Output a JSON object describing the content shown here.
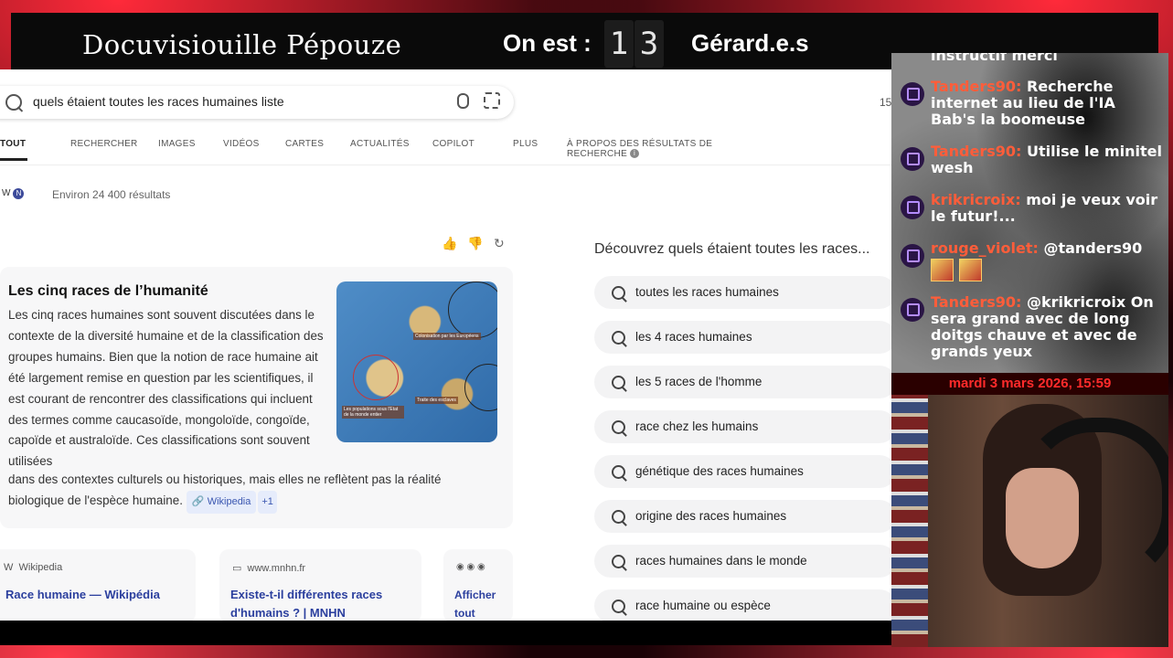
{
  "overlay": {
    "left_title": "Docuvisiouille Pépouze",
    "counter_label": "On est :",
    "counter_digits": [
      "1",
      "3"
    ],
    "right_title": "Gérard.e.s"
  },
  "search": {
    "query": "quels étaient toutes les races humaines liste",
    "corner_count": "15"
  },
  "tabs": [
    {
      "label": "TOUT",
      "active": true
    },
    {
      "label": "RECHERCHER"
    },
    {
      "label": "IMAGES"
    },
    {
      "label": "VIDÉOS"
    },
    {
      "label": "CARTES"
    },
    {
      "label": "ACTUALITÉS"
    },
    {
      "label": "COPILOT"
    },
    {
      "label": "PLUS"
    },
    {
      "label": "À PROPOS DES RÉSULTATS DE RECHERCHE"
    }
  ],
  "results": {
    "badge_w": "W",
    "badge_n": "N",
    "count": "Environ 24 400 résultats"
  },
  "answer_card": {
    "title": "Les cinq races de l’humanité",
    "body": "Les cinq races humaines sont souvent discutées dans le contexte de la diversité humaine et de la classification des groupes humains. Bien que la notion de race humaine ait été largement remise en question par les scientifiques, il est courant de rencontrer des classifications qui incluent des termes comme caucasoïde, mongoloïde, congoïde, capoïde et australoïde. Ces classifications sont souvent utilisées",
    "body_tail": "dans des contextes culturels ou historiques, mais elles ne reflètent pas la réalité biologique de l'espèce humaine.",
    "chip_wiki": "Wikipedia",
    "chip_plus": "+1",
    "map_labels": [
      "Colonisation par les Européens",
      "Traite des esclaves",
      "Les populations sous l'Etat de la monde entier"
    ]
  },
  "sources": [
    {
      "site": "Wikipedia",
      "title": "Race humaine — Wikipédia"
    },
    {
      "site": "www.mnhn.fr",
      "title": "Existe-t-il différentes races d'humains ? | MNHN"
    },
    {
      "title": "Afficher tout"
    }
  ],
  "aside": {
    "title": "Découvrez quels étaient toutes les races...",
    "suggestions": [
      "toutes les races humaines",
      "les 4 races humaines",
      "les 5 races de l'homme",
      "race chez les humains",
      "génétique des races humaines",
      "origine des races humaines",
      "races humaines dans le monde",
      "race humaine ou espèce"
    ]
  },
  "chat": {
    "messages": [
      {
        "user": "",
        "text": "instructif merci"
      },
      {
        "user": "Tanders90:",
        "text": "Recherche internet au lieu de l'IA Bab's la boomeuse"
      },
      {
        "user": "Tanders90:",
        "text": "Utilise le minitel wesh"
      },
      {
        "user": "krikricroix:",
        "text": "moi je veux voir le futur!..."
      },
      {
        "user": "rouge_violet:",
        "text": "@tanders90"
      },
      {
        "user": "Tanders90:",
        "text": "@krikricroix On sera grand avec de long doitgs chauve et avec de grands yeux"
      }
    ],
    "date": "mardi 3 mars 2026, 15:59"
  },
  "colors": {
    "accent_red": "#ff2a3a",
    "chat_user": "#ff5d3a",
    "date_red": "#ff2b2b",
    "link_blue": "#2b3f9e"
  }
}
